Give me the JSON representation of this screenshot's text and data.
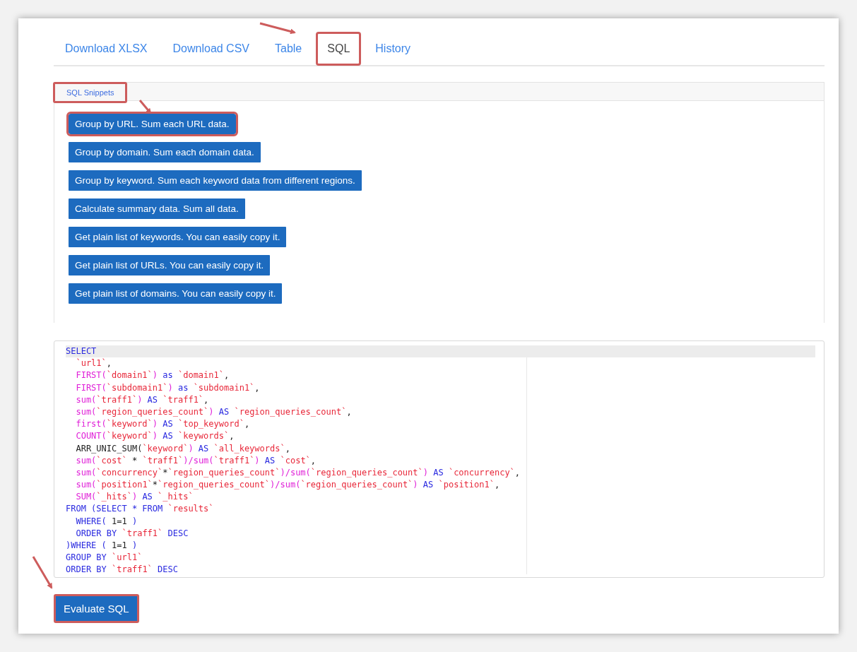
{
  "tabs": [
    {
      "label": "Download XLSX",
      "selected": false,
      "highlighted": false
    },
    {
      "label": "Download CSV",
      "selected": false,
      "highlighted": false
    },
    {
      "label": "Table",
      "selected": false,
      "highlighted": false
    },
    {
      "label": "SQL",
      "selected": true,
      "highlighted": true
    },
    {
      "label": "History",
      "selected": false,
      "highlighted": false
    }
  ],
  "snippets_panel": {
    "tab": {
      "label": "SQL Snippets",
      "highlighted": true
    },
    "buttons": [
      {
        "label": "Group by URL. Sum each URL data.",
        "highlighted": true
      },
      {
        "label": "Group by domain. Sum each domain data.",
        "highlighted": false
      },
      {
        "label": "Group by keyword. Sum each keyword data from different regions.",
        "highlighted": false
      },
      {
        "label": "Calculate summary data. Sum all data.",
        "highlighted": false
      },
      {
        "label": "Get plain list of keywords. You can easily copy it.",
        "highlighted": false
      },
      {
        "label": "Get plain list of URLs. You can easily copy it.",
        "highlighted": false
      },
      {
        "label": "Get plain list of domains. You can easily copy it.",
        "highlighted": false
      }
    ]
  },
  "editor": {
    "lines": [
      {
        "active": true,
        "tokens": [
          {
            "kind": "keyword",
            "t": "SELECT"
          }
        ]
      },
      {
        "active": false,
        "tokens": [
          {
            "kind": "identifier",
            "t": "  `url1`"
          },
          {
            "kind": "plain",
            "t": ","
          }
        ]
      },
      {
        "active": false,
        "tokens": [
          {
            "kind": "function",
            "t": "  FIRST("
          },
          {
            "kind": "identifier",
            "t": "`domain1`"
          },
          {
            "kind": "function",
            "t": ") "
          },
          {
            "kind": "keyword",
            "t": "as "
          },
          {
            "kind": "identifier",
            "t": "`domain1`"
          },
          {
            "kind": "plain",
            "t": ","
          }
        ]
      },
      {
        "active": false,
        "tokens": [
          {
            "kind": "function",
            "t": "  FIRST("
          },
          {
            "kind": "identifier",
            "t": "`subdomain1`"
          },
          {
            "kind": "function",
            "t": ") "
          },
          {
            "kind": "keyword",
            "t": "as "
          },
          {
            "kind": "identifier",
            "t": "`subdomain1`"
          },
          {
            "kind": "plain",
            "t": ","
          }
        ]
      },
      {
        "active": false,
        "tokens": [
          {
            "kind": "function",
            "t": "  sum("
          },
          {
            "kind": "identifier",
            "t": "`traff1`"
          },
          {
            "kind": "function",
            "t": ") "
          },
          {
            "kind": "keyword",
            "t": "AS "
          },
          {
            "kind": "identifier",
            "t": "`traff1`"
          },
          {
            "kind": "plain",
            "t": ","
          }
        ]
      },
      {
        "active": false,
        "tokens": [
          {
            "kind": "function",
            "t": "  sum("
          },
          {
            "kind": "identifier",
            "t": "`region_queries_count`"
          },
          {
            "kind": "function",
            "t": ") "
          },
          {
            "kind": "keyword",
            "t": "AS "
          },
          {
            "kind": "identifier",
            "t": "`region_queries_count`"
          },
          {
            "kind": "plain",
            "t": ","
          }
        ]
      },
      {
        "active": false,
        "tokens": [
          {
            "kind": "function",
            "t": "  first("
          },
          {
            "kind": "identifier",
            "t": "`keyword`"
          },
          {
            "kind": "function",
            "t": ") "
          },
          {
            "kind": "keyword",
            "t": "AS "
          },
          {
            "kind": "identifier",
            "t": "`top_keyword`"
          },
          {
            "kind": "plain",
            "t": ","
          }
        ]
      },
      {
        "active": false,
        "tokens": [
          {
            "kind": "function",
            "t": "  COUNT("
          },
          {
            "kind": "identifier",
            "t": "`keyword`"
          },
          {
            "kind": "function",
            "t": ") "
          },
          {
            "kind": "keyword",
            "t": "AS "
          },
          {
            "kind": "identifier",
            "t": "`keywords`"
          },
          {
            "kind": "plain",
            "t": ","
          }
        ]
      },
      {
        "active": false,
        "tokens": [
          {
            "kind": "plain",
            "t": "  ARR_UNIC_SUM("
          },
          {
            "kind": "identifier",
            "t": "`keyword`"
          },
          {
            "kind": "function",
            "t": ") "
          },
          {
            "kind": "keyword",
            "t": "AS "
          },
          {
            "kind": "identifier",
            "t": "`all_keywords`"
          },
          {
            "kind": "plain",
            "t": ","
          }
        ]
      },
      {
        "active": false,
        "tokens": [
          {
            "kind": "function",
            "t": "  sum("
          },
          {
            "kind": "identifier",
            "t": "`cost`"
          },
          {
            "kind": "plain",
            "t": " * "
          },
          {
            "kind": "identifier",
            "t": "`traff1`"
          },
          {
            "kind": "function",
            "t": ")/sum("
          },
          {
            "kind": "identifier",
            "t": "`traff1`"
          },
          {
            "kind": "function",
            "t": ") "
          },
          {
            "kind": "keyword",
            "t": "AS "
          },
          {
            "kind": "identifier",
            "t": "`cost`"
          },
          {
            "kind": "plain",
            "t": ","
          }
        ]
      },
      {
        "active": false,
        "tokens": [
          {
            "kind": "function",
            "t": "  sum("
          },
          {
            "kind": "identifier",
            "t": "`concurrency`"
          },
          {
            "kind": "plain",
            "t": "*"
          },
          {
            "kind": "identifier",
            "t": "`region_queries_count`"
          },
          {
            "kind": "function",
            "t": ")/sum("
          },
          {
            "kind": "identifier",
            "t": "`region_queries_count`"
          },
          {
            "kind": "function",
            "t": ") "
          },
          {
            "kind": "keyword",
            "t": "AS "
          },
          {
            "kind": "identifier",
            "t": "`concurrency`"
          },
          {
            "kind": "plain",
            "t": ","
          }
        ]
      },
      {
        "active": false,
        "tokens": [
          {
            "kind": "function",
            "t": "  sum("
          },
          {
            "kind": "identifier",
            "t": "`position1`"
          },
          {
            "kind": "plain",
            "t": "*"
          },
          {
            "kind": "identifier",
            "t": "`region_queries_count`"
          },
          {
            "kind": "function",
            "t": ")/sum("
          },
          {
            "kind": "identifier",
            "t": "`region_queries_count`"
          },
          {
            "kind": "function",
            "t": ") "
          },
          {
            "kind": "keyword",
            "t": "AS "
          },
          {
            "kind": "identifier",
            "t": "`position1`"
          },
          {
            "kind": "plain",
            "t": ","
          }
        ]
      },
      {
        "active": false,
        "tokens": [
          {
            "kind": "function",
            "t": "  SUM("
          },
          {
            "kind": "identifier",
            "t": "`_hits`"
          },
          {
            "kind": "function",
            "t": ") "
          },
          {
            "kind": "keyword",
            "t": "AS "
          },
          {
            "kind": "identifier",
            "t": "`_hits`"
          }
        ]
      },
      {
        "active": false,
        "tokens": [
          {
            "kind": "keyword",
            "t": "FROM (SELECT * FROM "
          },
          {
            "kind": "identifier",
            "t": "`results`"
          }
        ]
      },
      {
        "active": false,
        "tokens": [
          {
            "kind": "keyword",
            "t": "  WHERE( "
          },
          {
            "kind": "plain",
            "t": "1=1"
          },
          {
            "kind": "keyword",
            "t": " )"
          }
        ]
      },
      {
        "active": false,
        "tokens": [
          {
            "kind": "keyword",
            "t": "  ORDER BY "
          },
          {
            "kind": "identifier",
            "t": "`traff1`"
          },
          {
            "kind": "keyword",
            "t": " DESC"
          }
        ]
      },
      {
        "active": false,
        "tokens": [
          {
            "kind": "keyword",
            "t": ")WHERE ( "
          },
          {
            "kind": "plain",
            "t": "1=1"
          },
          {
            "kind": "keyword",
            "t": " )"
          }
        ]
      },
      {
        "active": false,
        "tokens": [
          {
            "kind": "keyword",
            "t": "GROUP BY "
          },
          {
            "kind": "identifier",
            "t": "`url1`"
          }
        ]
      },
      {
        "active": false,
        "tokens": [
          {
            "kind": "keyword",
            "t": "ORDER BY "
          },
          {
            "kind": "identifier",
            "t": "`traff1`"
          },
          {
            "kind": "keyword",
            "t": " DESC"
          }
        ]
      }
    ]
  },
  "evaluate_button": {
    "label": "Evaluate SQL",
    "highlighted": true
  }
}
